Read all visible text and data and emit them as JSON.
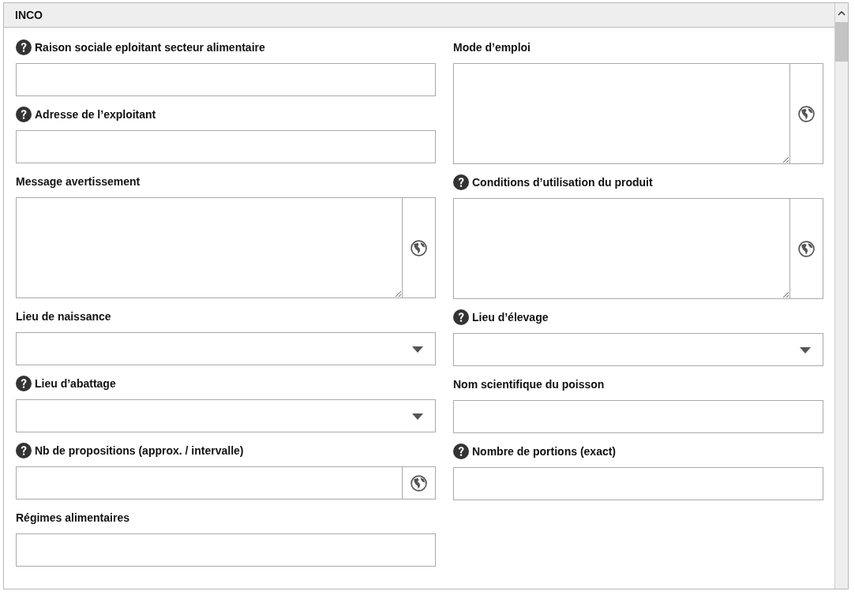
{
  "panel": {
    "title": "INCO"
  },
  "columns": [
    {
      "fields": [
        {
          "label": "Raison sociale eploitant secteur alimentaire",
          "help": true,
          "kind": "text"
        },
        {
          "label": "Adresse de l’exploitant",
          "help": true,
          "kind": "text"
        },
        {
          "label": "Message avertissement",
          "help": false,
          "kind": "textarea"
        },
        {
          "label": "Lieu de naissance",
          "help": false,
          "kind": "select"
        },
        {
          "label": "Lieu d’abattage",
          "help": true,
          "kind": "select"
        },
        {
          "label": "Nb de propositions (approx. / intervalle)",
          "help": true,
          "kind": "text-globe"
        },
        {
          "label": "Régimes alimentaires",
          "help": false,
          "kind": "text"
        }
      ]
    },
    {
      "fields": [
        {
          "label": "Mode d’emploi",
          "help": false,
          "kind": "textarea"
        },
        {
          "label": "Conditions d’utilisation du produit",
          "help": true,
          "kind": "textarea"
        },
        {
          "label": "Lieu d’élevage",
          "help": true,
          "kind": "select"
        },
        {
          "label": "Nom scientifique du poisson",
          "help": false,
          "kind": "text"
        },
        {
          "label": "Nombre de portions (exact)",
          "help": true,
          "kind": "text"
        }
      ]
    }
  ]
}
